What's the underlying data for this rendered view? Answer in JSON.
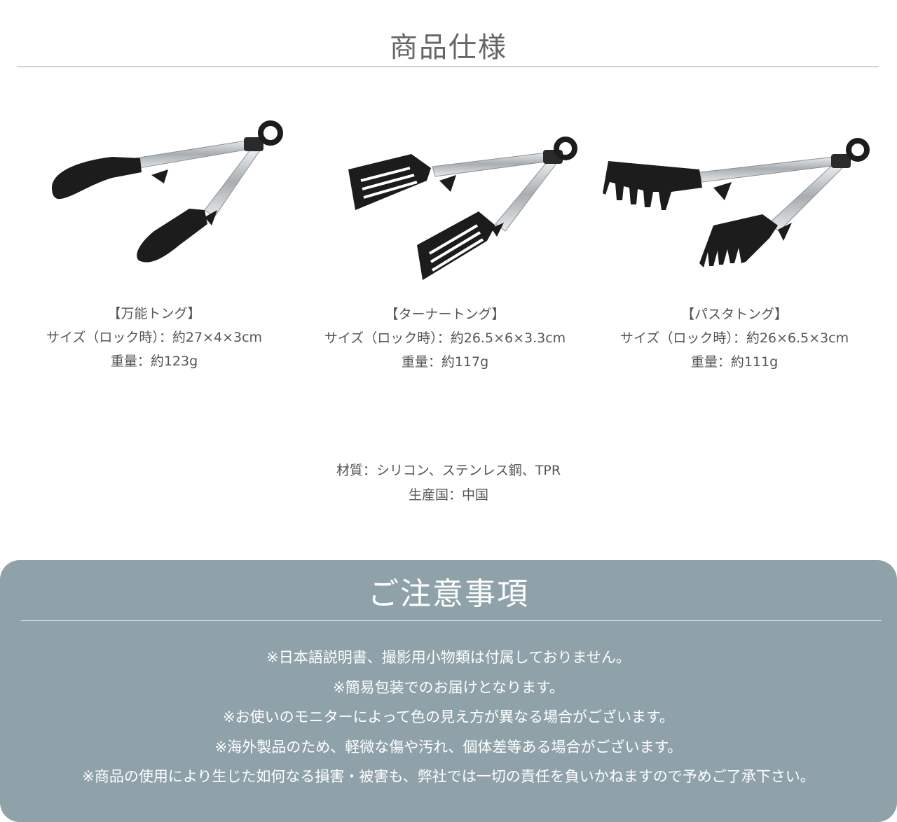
{
  "spec": {
    "title": "商品仕様"
  },
  "products": [
    {
      "name": "【万能トング】",
      "size": "サイズ（ロック時）：約27×4×3cm",
      "weight": "重量：約123g"
    },
    {
      "name": "【ターナートング】",
      "size": "サイズ（ロック時）：約26.5×6×3.3cm",
      "weight": "重量：約117g"
    },
    {
      "name": "【パスタトング】",
      "size": "サイズ（ロック時）：約26×6.5×3cm",
      "weight": "重量：約111g"
    }
  ],
  "materials": {
    "material": "材質：シリコン、ステンレス鋼、TPR",
    "origin": "生産国：中国"
  },
  "notice": {
    "title": "ご注意事項",
    "items": [
      "※日本語説明書、撮影用小物類は付属しておりません。",
      "※簡易包装でのお届けとなります。",
      "※お使いのモニターによって色の見え方が異なる場合がございます。",
      "※海外製品のため、軽微な傷や汚れ、個体差等ある場合がございます。",
      "※商品の使用により生じた如何なる損害・被害も、弊社では一切の責任を負いかねますので予めご了承下さい。"
    ]
  },
  "colors": {
    "notice_bg": "#8fa2aa",
    "silicone": "#1c1c1c",
    "steel": "#c9cdd0"
  }
}
